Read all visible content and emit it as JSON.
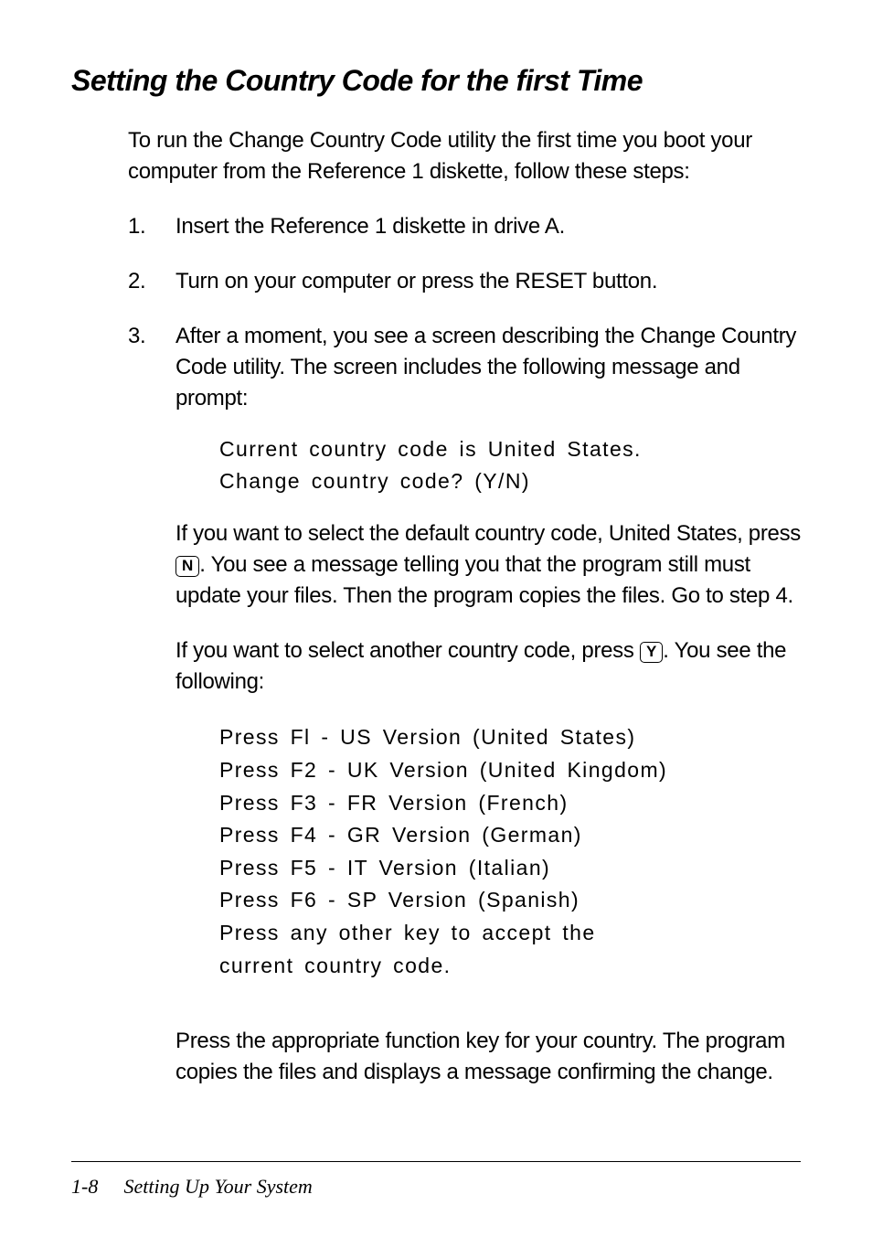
{
  "heading": "Setting the Country Code for the first Time",
  "intro": "To run the Change Country Code utility the first time you boot your computer from the Reference 1 diskette, follow these steps:",
  "steps": [
    {
      "num": "1.",
      "text": "Insert the Reference 1 diskette in drive A."
    },
    {
      "num": "2.",
      "text": "Turn on your computer or press the RESET button."
    },
    {
      "num": "3.",
      "text": "After a moment, you see a screen describing the Change Country Code utility. The screen includes the following message and prompt:"
    }
  ],
  "mono1_lines": [
    "Current country code is United States.",
    "",
    "Change country code? (Y/N)"
  ],
  "para_after_mono1_before": "If you want to select the default country code, United States, press ",
  "key_n": "N",
  "para_after_mono1_after": ". You see a message telling you that the program still must update your files. Then the program copies the files. Go to step 4.",
  "para_select_another_before": "If you want to select another country code, press ",
  "key_y": "Y",
  "para_select_another_after": ". You see the following:",
  "mono2_lines": [
    "Press Fl - US Version (United States)",
    "Press F2 - UK Version (United Kingdom)",
    "Press F3 - FR Version (French)",
    "Press F4 - GR Version (German)",
    "Press F5 - IT Version (Italian)",
    "Press F6 - SP Version (Spanish)",
    "Press any other key to accept the",
    "current country code."
  ],
  "closing": "Press the appropriate function key for your country. The program copies the files and displays a message confirming the change.",
  "footer": {
    "page": "1-8",
    "title": "Setting Up Your System"
  }
}
